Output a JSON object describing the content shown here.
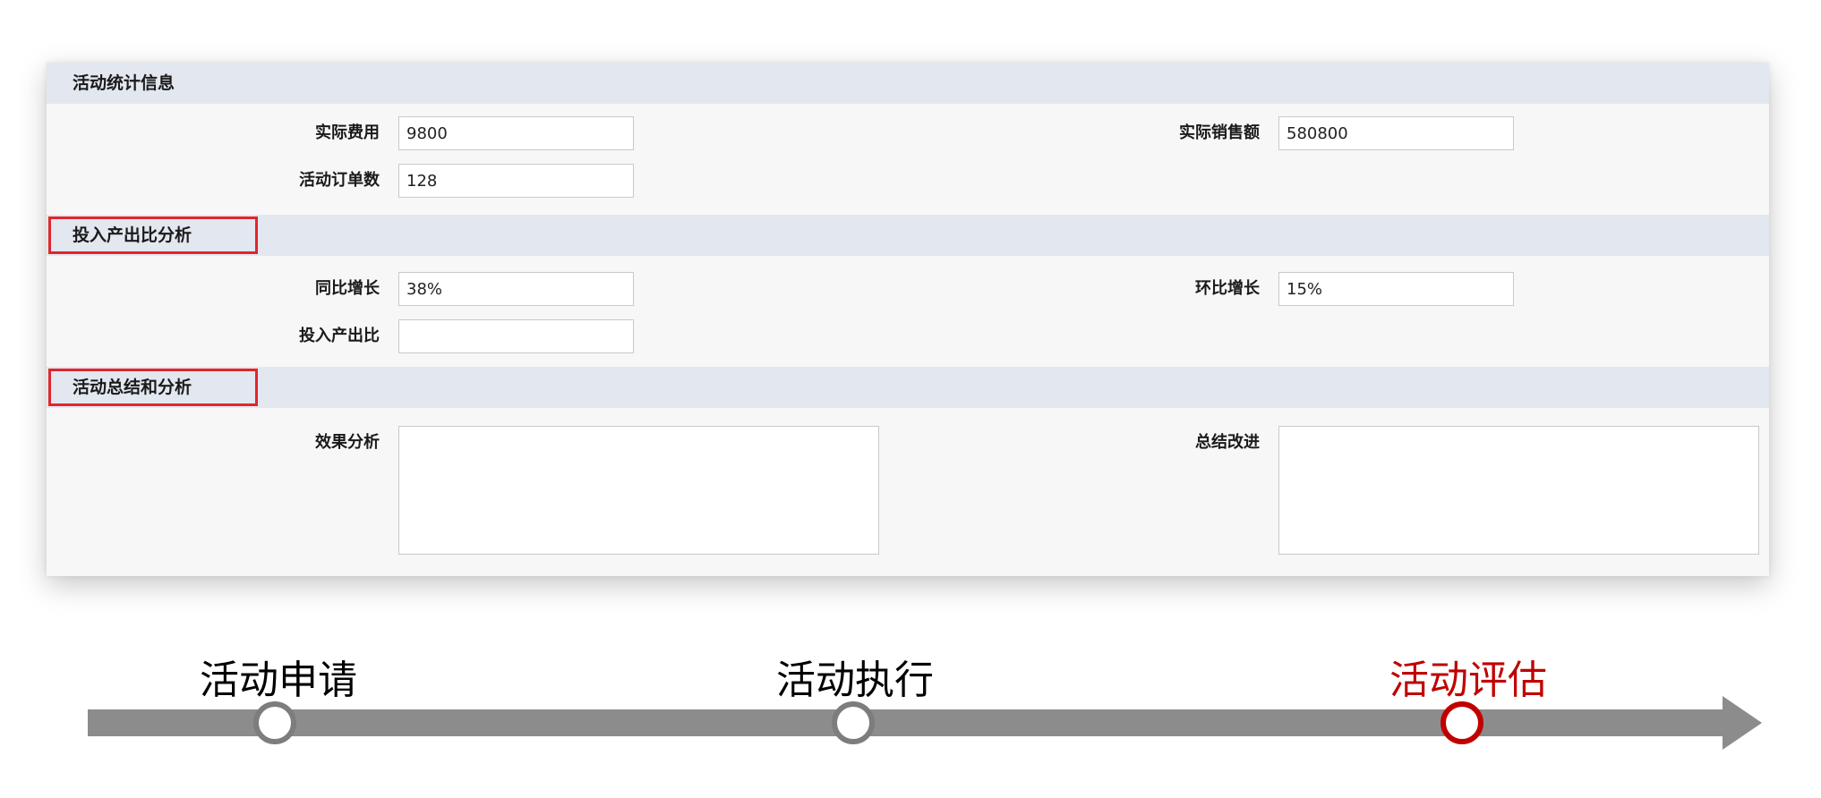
{
  "sections": {
    "stats": {
      "title": "活动统计信息",
      "actual_cost_label": "实际费用",
      "actual_cost_value": "9800",
      "actual_sales_label": "实际销售额",
      "actual_sales_value": "580800",
      "order_count_label": "活动订单数",
      "order_count_value": "128"
    },
    "roi": {
      "title": "投入产出比分析",
      "yoy_label": "同比增长",
      "yoy_value": "38%",
      "mom_label": "环比增长",
      "mom_value": "15%",
      "ratio_label": "投入产出比",
      "ratio_value": ""
    },
    "summary": {
      "title": "活动总结和分析",
      "effect_label": "效果分析",
      "effect_value": "",
      "improve_label": "总结改进",
      "improve_value": ""
    }
  },
  "timeline": {
    "steps": [
      {
        "label": "活动申请",
        "active": false
      },
      {
        "label": "活动执行",
        "active": false
      },
      {
        "label": "活动评估",
        "active": true
      }
    ],
    "active_color": "#c00000",
    "inactive_color": "#7d7d7d"
  }
}
